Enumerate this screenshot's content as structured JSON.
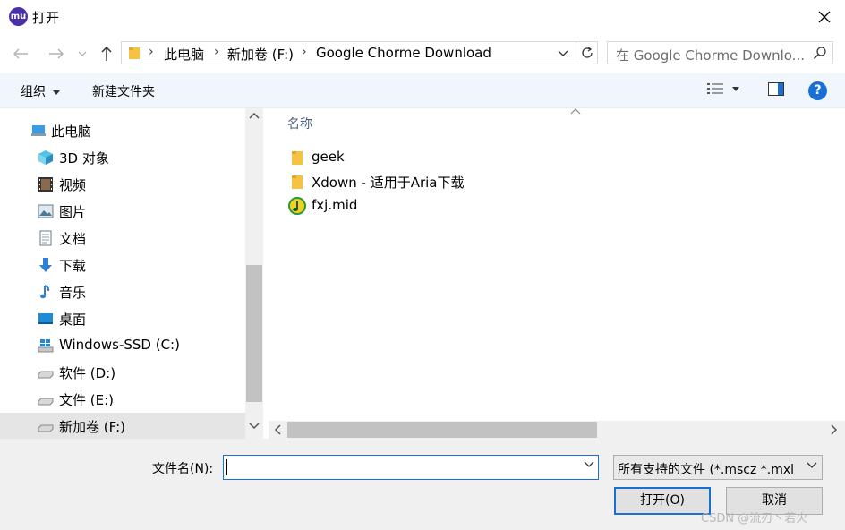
{
  "window": {
    "title": "打开",
    "app_icon_text": "mu"
  },
  "navigation": {
    "breadcrumbs": [
      "此电脑",
      "新加卷 (F:)",
      "Google Chorme Download"
    ],
    "search_placeholder": "在 Google Chorme Downlo..."
  },
  "toolbar": {
    "organize_label": "组织",
    "new_folder_label": "新建文件夹",
    "help_label": "?"
  },
  "sidebar": {
    "items": [
      {
        "label": "此电脑",
        "icon": "computer-icon"
      },
      {
        "label": "3D 对象",
        "icon": "cube-3d-icon"
      },
      {
        "label": "视频",
        "icon": "video-icon"
      },
      {
        "label": "图片",
        "icon": "picture-icon"
      },
      {
        "label": "文档",
        "icon": "document-icon"
      },
      {
        "label": "下载",
        "icon": "download-icon"
      },
      {
        "label": "音乐",
        "icon": "music-icon"
      },
      {
        "label": "桌面",
        "icon": "desktop-icon"
      },
      {
        "label": "Windows-SSD (C:)",
        "icon": "windows-drive-icon"
      },
      {
        "label": "软件 (D:)",
        "icon": "drive-icon"
      },
      {
        "label": "文件 (E:)",
        "icon": "drive-icon"
      },
      {
        "label": "新加卷 (F:)",
        "icon": "drive-icon",
        "selected": true
      }
    ]
  },
  "filelist": {
    "column_name": "名称",
    "files": [
      {
        "name": "geek",
        "type": "folder"
      },
      {
        "name": "Xdown - 适用于Aria下载",
        "type": "folder"
      },
      {
        "name": "fxj.mid",
        "type": "midi"
      }
    ]
  },
  "bottom": {
    "filename_label": "文件名(N):",
    "filename_value": "",
    "filter_value": "所有支持的文件 (*.mscz *.mxl",
    "open_label": "打开(O)",
    "cancel_label": "取消"
  },
  "watermark": "CSDN @流刃丶若火",
  "colors": {
    "accent": "#1a6fd6",
    "selected_bg": "#e5e5e5",
    "toolbar_bg": "#f0f6fb",
    "folder_yellow": "#f5c242"
  }
}
